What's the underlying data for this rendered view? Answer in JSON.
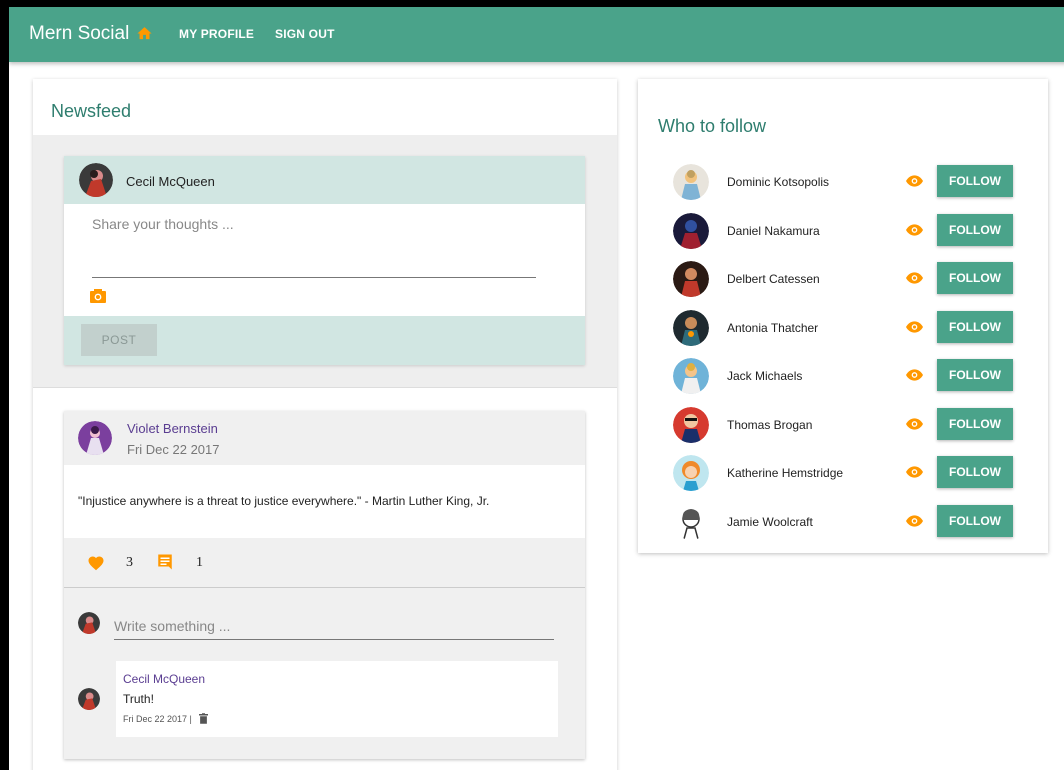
{
  "app": {
    "title": "Mern Social"
  },
  "nav": {
    "my_profile": "MY PROFILE",
    "sign_out": "SIGN OUT"
  },
  "colors": {
    "primary": "#4aa38a",
    "accent": "#ff9800",
    "purple": "#5a3d91"
  },
  "newsfeed": {
    "title": "Newsfeed",
    "new_post": {
      "user_name": "Cecil McQueen",
      "placeholder": "Share your thoughts ...",
      "post_button": "POST",
      "camera_icon": "camera-icon"
    },
    "posts": [
      {
        "author": "Violet Bernstein",
        "date": "Fri Dec 22 2017",
        "text": "\"Injustice anywhere is a threat to justice everywhere.\" - Martin Luther King, Jr.",
        "likes": "3",
        "comments": "1",
        "comment_placeholder": "Write something ...",
        "comment_list": [
          {
            "author": "Cecil McQueen",
            "text": "Truth!",
            "date": "Fri Dec 22 2017 |"
          }
        ]
      }
    ]
  },
  "who_to_follow": {
    "title": "Who to follow",
    "follow_label": "FOLLOW",
    "users": [
      {
        "name": "Dominic Kotsopolis"
      },
      {
        "name": "Daniel Nakamura"
      },
      {
        "name": "Delbert Catessen"
      },
      {
        "name": "Antonia Thatcher"
      },
      {
        "name": "Jack Michaels"
      },
      {
        "name": "Thomas Brogan"
      },
      {
        "name": "Katherine Hemstridge"
      },
      {
        "name": "Jamie Woolcraft"
      }
    ]
  }
}
